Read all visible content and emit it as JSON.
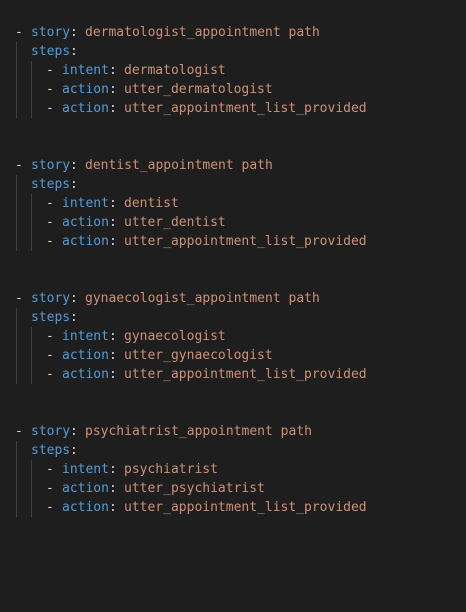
{
  "stories": [
    {
      "story_key": "story",
      "story_name": "dermatologist_appointment path",
      "steps_key": "steps",
      "steps": [
        {
          "key": "intent",
          "value": "dermatologist"
        },
        {
          "key": "action",
          "value": "utter_dermatologist"
        },
        {
          "key": "action",
          "value": "utter_appointment_list_provided"
        }
      ]
    },
    {
      "story_key": "story",
      "story_name": "dentist_appointment path",
      "steps_key": "steps",
      "steps": [
        {
          "key": "intent",
          "value": "dentist"
        },
        {
          "key": "action",
          "value": "utter_dentist"
        },
        {
          "key": "action",
          "value": "utter_appointment_list_provided"
        }
      ]
    },
    {
      "story_key": "story",
      "story_name": "gynaecologist_appointment path",
      "steps_key": "steps",
      "steps": [
        {
          "key": "intent",
          "value": "gynaecologist"
        },
        {
          "key": "action",
          "value": "utter_gynaecologist"
        },
        {
          "key": "action",
          "value": "utter_appointment_list_provided"
        }
      ]
    },
    {
      "story_key": "story",
      "story_name": "psychiatrist_appointment path",
      "steps_key": "steps",
      "steps": [
        {
          "key": "intent",
          "value": "psychiatrist"
        },
        {
          "key": "action",
          "value": "utter_psychiatrist"
        },
        {
          "key": "action",
          "value": "utter_appointment_list_provided"
        }
      ]
    }
  ],
  "colors": {
    "background": "#1e1e1e",
    "key": "#569cd6",
    "string": "#ce9178",
    "punctuation": "#d4d4d4",
    "indent_guide": "#404040"
  }
}
